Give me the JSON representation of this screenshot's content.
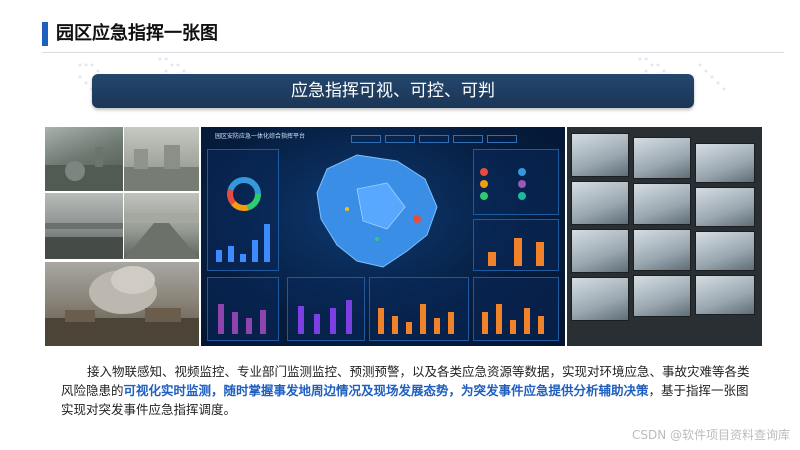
{
  "header": {
    "title": "园区应急指挥一张图",
    "accent_color": "#1e5fbf"
  },
  "banner": {
    "text": "应急指挥可视、可控、可判",
    "background": "#1f3d63"
  },
  "dashboard": {
    "title": "园区安防应急一体化综合指挥平台",
    "tabs": [
      "",
      "",
      "",
      "",
      ""
    ]
  },
  "paragraph": {
    "part1": "接入物联感知、视频监控、专业部门监测监控、预测预警，以及各类应急资源等数据，实现对环境应急、事故灾难等各类风险隐患的",
    "highlight": "可视化实时监测，随时掌握事发地周边情况及现场发展态势，为突发事件应急提供分析辅助决策",
    "part2": "，基于指挥一张图实现对突发事件应急指挥调度。",
    "highlight_color": "#1e5fbf"
  },
  "footer": {
    "watermark": "CSDN @软件项目资料查询库"
  }
}
